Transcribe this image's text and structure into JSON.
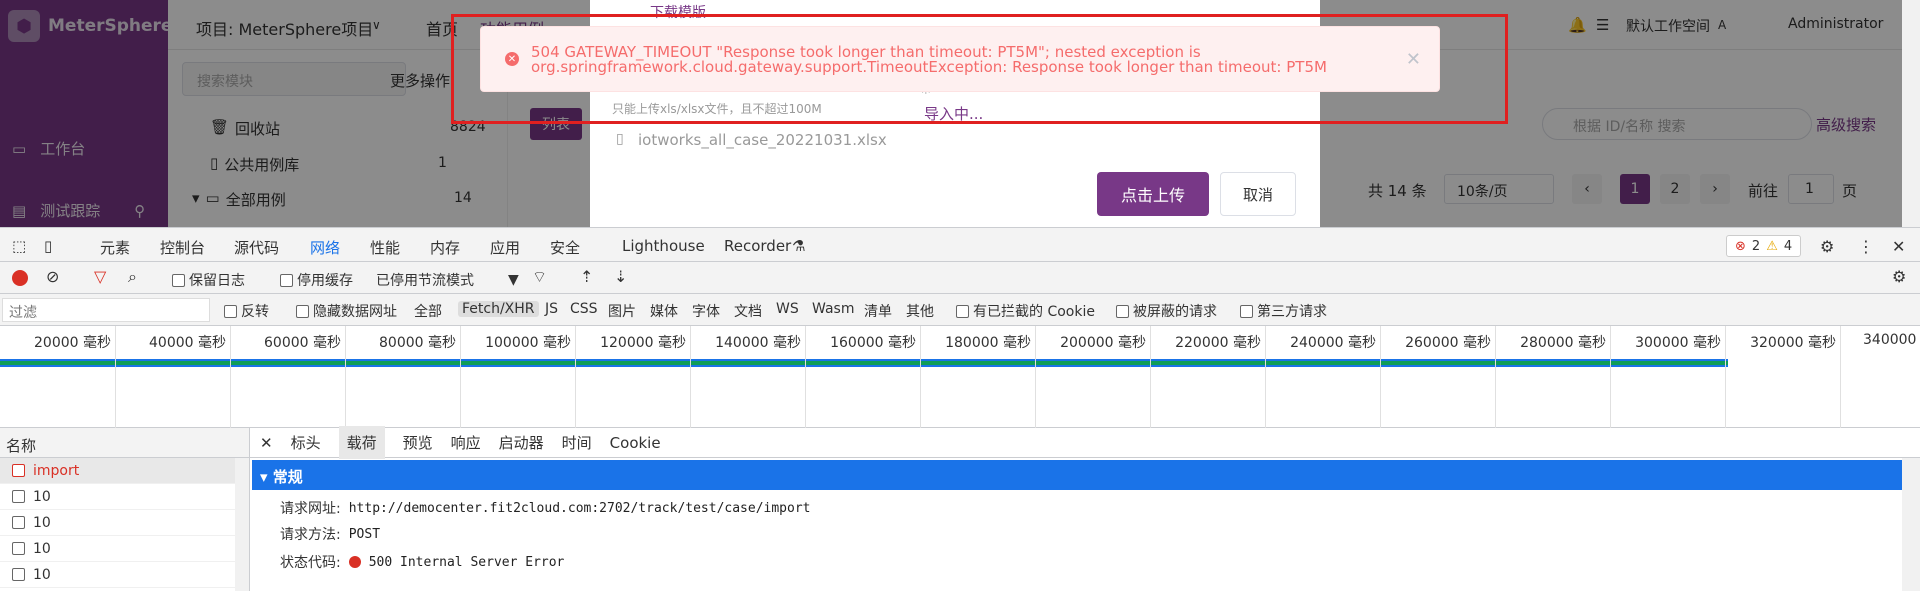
{
  "app": {
    "logo_text": "MeterSphere",
    "sidebar": {
      "workbench": "工作台",
      "tracking": "测试跟踪"
    },
    "topbar": {
      "project": "项目: MeterSphere项目",
      "home": "首页",
      "cases": "功能用例",
      "workspace": "默认工作空间",
      "user": "Administrator"
    },
    "left_panel": {
      "search_placeholder": "搜索模块",
      "more_ops": "更多操作",
      "tree": [
        {
          "label": "回收站",
          "count": "8824"
        },
        {
          "label": "公共用例库",
          "count": "1"
        },
        {
          "label": "全部用例",
          "count": "14"
        }
      ]
    },
    "main": {
      "list_tab": "列表",
      "search_placeholder": "根据 ID/名称 搜索",
      "advanced": "高级搜索",
      "total": "共 14 条",
      "page_size": "10条/页",
      "pages": [
        "1",
        "2"
      ],
      "goto": "前往",
      "goto_value": "1",
      "page_suffix": "页"
    },
    "dialog": {
      "download_template": "下载模版",
      "hint": "只能上传xls/xlsx文件，且不超过100M",
      "file_name": "iotworks_all_case_20221031.xlsx",
      "importing": "导入中...",
      "upload": "点击上传",
      "cancel": "取消"
    },
    "alert": {
      "line1": "504 GATEWAY_TIMEOUT \"Response took longer than timeout: PT5M\"; nested exception is",
      "line2": "org.springframework.cloud.gateway.support.TimeoutException: Response took longer than timeout: PT5M"
    }
  },
  "devtools": {
    "tabs": [
      "元素",
      "控制台",
      "源代码",
      "网络",
      "性能",
      "内存",
      "应用",
      "安全",
      "Lighthouse",
      "Recorder"
    ],
    "active_tab": "网络",
    "errors": "2",
    "warnings": "4",
    "toolbar": {
      "preserve_log": "保留日志",
      "disable_cache": "停用缓存",
      "throttle": "已停用节流模式"
    },
    "filter": {
      "placeholder": "过滤",
      "invert": "反转",
      "hide_data": "隐藏数据网址",
      "all": "全部",
      "types": [
        "Fetch/XHR",
        "JS",
        "CSS",
        "图片",
        "媒体",
        "字体",
        "文档",
        "WS",
        "Wasm",
        "清单",
        "其他"
      ],
      "blocked_cookies": "有已拦截的 Cookie",
      "blocked_requests": "被屏蔽的请求",
      "third_party": "第三方请求"
    },
    "timeline_ticks": [
      "20000 毫秒",
      "40000 毫秒",
      "60000 毫秒",
      "80000 毫秒",
      "100000 毫秒",
      "120000 毫秒",
      "140000 毫秒",
      "160000 毫秒",
      "180000 毫秒",
      "200000 毫秒",
      "220000 毫秒",
      "240000 毫秒",
      "260000 毫秒",
      "280000 毫秒",
      "300000 毫秒",
      "320000 毫秒",
      "340000"
    ],
    "name_header": "名称",
    "requests": [
      "import",
      "10",
      "10",
      "10",
      "10"
    ],
    "detail_tabs": [
      "标头",
      "载荷",
      "预览",
      "响应",
      "启动器",
      "时间",
      "Cookie"
    ],
    "general_title": "常规",
    "general": {
      "url_label": "请求网址:",
      "url": "http://democenter.fit2cloud.com:2702/track/test/case/import",
      "method_label": "请求方法:",
      "method": "POST",
      "status_label": "状态代码:",
      "status": "500 Internal Server Error"
    }
  }
}
